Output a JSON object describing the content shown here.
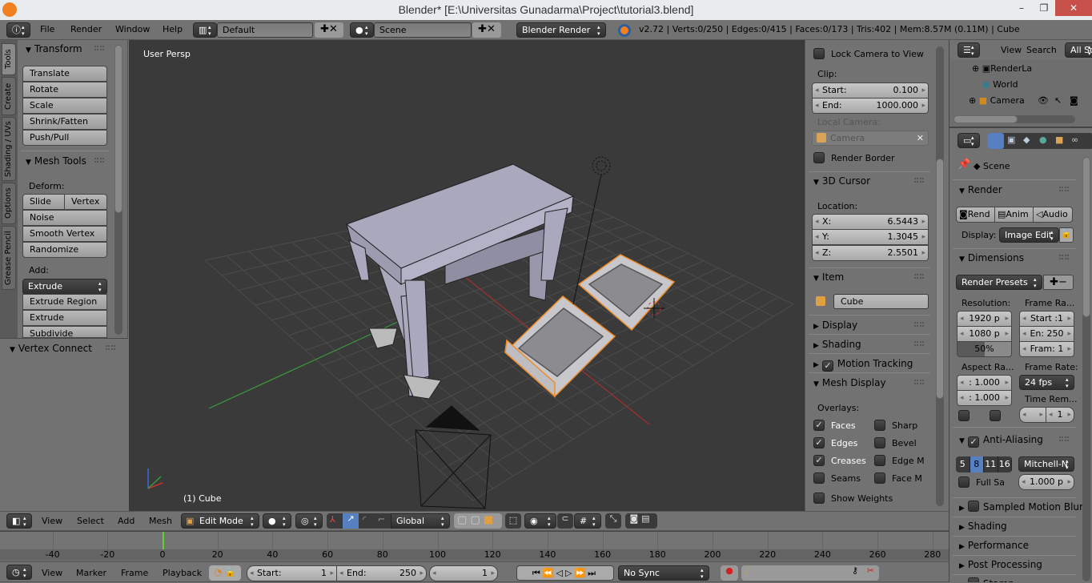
{
  "window": {
    "title": "Blender* [E:\\Universitas Gunadarma\\Project\\tutorial3.blend]",
    "minimize": "–",
    "maximize": "❐",
    "close": "✕"
  },
  "info_header": {
    "menus": [
      "File",
      "Render",
      "Window",
      "Help"
    ],
    "layout": "Default",
    "scene": "Scene",
    "engine": "Blender Render",
    "stats": "v2.72 | Verts:0/250 | Edges:0/415 | Faces:0/173 | Tris:402 | Mem:8.57M (0.11M) | Cube"
  },
  "toolshelf": {
    "tabs": [
      "Tools",
      "Create",
      "Shading / UVs",
      "Options",
      "Grease Pencil"
    ],
    "transform": {
      "title": "Transform",
      "buttons": [
        "Translate",
        "Rotate",
        "Scale",
        "Shrink/Fatten",
        "Push/Pull"
      ]
    },
    "mesh_tools": {
      "title": "Mesh Tools",
      "deform_label": "Deform:",
      "slide": "Slide Ed",
      "vertex": "Vertex",
      "deform": [
        "Noise",
        "Smooth Vertex",
        "Randomize"
      ],
      "add_label": "Add:",
      "extrude": "Extrude",
      "add": [
        "Extrude Region",
        "Extrude Individual",
        "Subdivide"
      ]
    },
    "operator": "Vertex Connect"
  },
  "viewport": {
    "view_name": "User Persp",
    "object_name": "(1) Cube"
  },
  "npanel": {
    "lock_camera": "Lock Camera to View",
    "clip_label": "Clip:",
    "clip_start_label": "Start:",
    "clip_start": "0.100",
    "clip_end_label": "End:",
    "clip_end": "1000.000",
    "local_camera_label": "Local Camera:",
    "local_camera": "Camera",
    "render_border": "Render Border",
    "cursor_title": "3D Cursor",
    "location_label": "Location:",
    "x_label": "X:",
    "x": "6.5443",
    "y_label": "Y:",
    "y": "1.3045",
    "z_label": "Z:",
    "z": "2.5501",
    "item_title": "Item",
    "item_name": "Cube",
    "display": "Display",
    "shading": "Shading",
    "motion_tracking": "Motion Tracking",
    "mesh_display": "Mesh Display",
    "overlays_label": "Overlays:",
    "overlays": [
      {
        "label": "Faces",
        "checked": true
      },
      {
        "label": "Sharp",
        "checked": false
      },
      {
        "label": "Edges",
        "checked": true
      },
      {
        "label": "Bevel",
        "checked": false
      },
      {
        "label": "Creases",
        "checked": true
      },
      {
        "label": "Edge M",
        "checked": false
      },
      {
        "label": "Seams",
        "checked": false
      },
      {
        "label": "Face M",
        "checked": false
      }
    ],
    "show_weights": "Show Weights"
  },
  "outliner": {
    "view": "View",
    "search": "Search",
    "filter": "All Sc",
    "items": [
      "RenderLa",
      "World",
      "Camera"
    ]
  },
  "properties": {
    "context": "Scene",
    "render_title": "Render",
    "rend": "Rend",
    "anim": "Anim",
    "audio": "Audio",
    "display_label": "Display:",
    "display": "Image Edit",
    "dimensions_title": "Dimensions",
    "presets": "Render Presets",
    "resolution_label": "Resolution:",
    "res_x": "1920 p",
    "res_y": "1080 p",
    "res_pct": "50%",
    "res_pct_value": 50,
    "frame_range_label": "Frame Ra...",
    "start": "Start :1",
    "end": "En: 250",
    "frame": "Fram: 1",
    "aspect_label": "Aspect Ra...",
    "aspect_x": ": 1.000",
    "aspect_y": ": 1.000",
    "frame_rate_label": "Frame Rate:",
    "fps": "24 fps",
    "time_remap_label": "Time Rem...",
    "time_remap": "1",
    "aa_title": "Anti-Aliasing",
    "aa_samples": [
      "5",
      "8",
      "11",
      "16"
    ],
    "aa_selected": "8",
    "filter": "Mitchell-N",
    "full_sample": "Full Sa",
    "filter_size": "1.000 p",
    "collapsed": [
      "Sampled Motion Blur",
      "Shading",
      "Performance",
      "Post Processing",
      "Stamp"
    ]
  },
  "view3d_header": {
    "menus": [
      "View",
      "Select",
      "Add",
      "Mesh"
    ],
    "mode": "Edit Mode",
    "orientation": "Global"
  },
  "timeline": {
    "ticks": [
      -40,
      -20,
      0,
      20,
      40,
      60,
      80,
      100,
      120,
      140,
      160,
      180,
      200,
      220,
      240,
      260,
      280
    ],
    "current_frame": 1
  },
  "timeline_header": {
    "menus": [
      "View",
      "Marker",
      "Frame",
      "Playback"
    ],
    "start_label": "Start:",
    "start": "1",
    "end_label": "End:",
    "end": "250",
    "current": "1",
    "sync": "No Sync"
  },
  "colors": {
    "accent_blue": "#5680c2",
    "selection_orange": "#f08c28",
    "x_axis": "#c83232",
    "y_axis": "#32a032"
  }
}
